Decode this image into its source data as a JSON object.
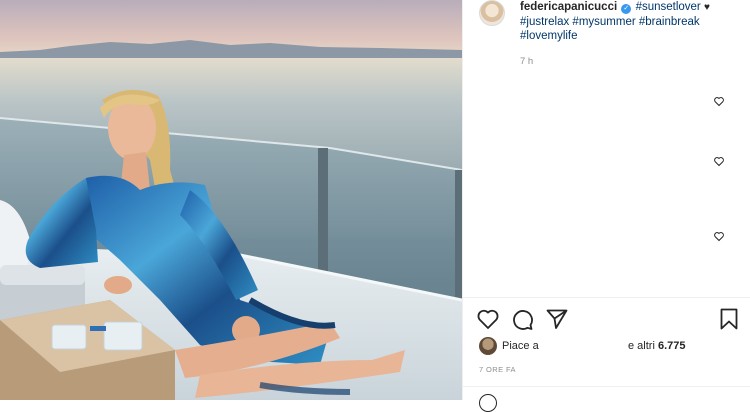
{
  "post": {
    "image_alt": "Woman in a blue patterned dress sitting on a yacht deck at sunset",
    "author": {
      "username": "federicapanicucci",
      "verified": true
    },
    "caption": {
      "first_tag": "#sunsetlover",
      "heart": "♥",
      "tags": [
        "#justrelax",
        "#mysummer",
        "#brainbreak",
        "#lovemylife"
      ]
    },
    "caption_time": "7 h",
    "actions": {
      "like": "heart-icon",
      "comment": "comment-icon",
      "share": "share-icon",
      "save": "bookmark-icon"
    },
    "likes": {
      "prefix": "Piace a",
      "suffix_label": "e altri",
      "count": "6.775"
    },
    "post_age": "7 ORE FA"
  },
  "colors": {
    "link": "#00376b",
    "verified": "#3897f0",
    "muted": "#8e8e8e",
    "text": "#262626"
  }
}
